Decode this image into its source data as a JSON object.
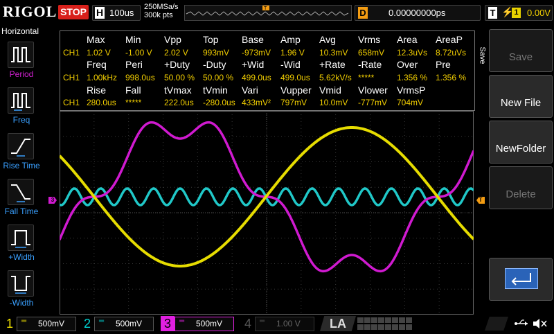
{
  "topbar": {
    "logo": "RIGOL",
    "run_state": "STOP",
    "h_label": "H",
    "timebase": "100us",
    "sample_rate": "250MSa/s",
    "memory_depth": "300k pts",
    "d_label": "D",
    "delay": "0.00000000ps",
    "t_label": "T",
    "trigger_edge_symbol": "⚡",
    "trigger_source": "1",
    "trigger_level": "0.00V"
  },
  "left_menu": {
    "title": "Horizontal",
    "items": [
      {
        "label": "Period",
        "icon": "period-icon",
        "active": true
      },
      {
        "label": "Freq",
        "icon": "freq-icon",
        "active": false
      },
      {
        "label": "Rise Time",
        "icon": "rise-time-icon",
        "active": false
      },
      {
        "label": "Fall Time",
        "icon": "fall-time-icon",
        "active": false
      },
      {
        "label": "+Width",
        "icon": "pos-width-icon",
        "active": false
      },
      {
        "label": "-Width",
        "icon": "neg-width-icon",
        "active": false
      }
    ]
  },
  "right_menu": {
    "tab_label": "Save",
    "buttons": [
      {
        "label": "Save",
        "enabled": false
      },
      {
        "label": "New File",
        "enabled": true
      },
      {
        "label": "NewFolder",
        "enabled": true
      },
      {
        "label": "Delete",
        "enabled": false
      },
      {
        "label": "",
        "icon": "return-icon",
        "enabled": true
      }
    ]
  },
  "measurements": {
    "rows": [
      {
        "headers": [
          "Max",
          "Min",
          "Vpp",
          "Top",
          "Base",
          "Amp",
          "Avg",
          "Vrms",
          "Area",
          "AreaP"
        ],
        "channel": "CH1",
        "values": [
          "1.02 V",
          "-1.00 V",
          "2.02 V",
          "993mV",
          "-973mV",
          "1.96 V",
          "10.3mV",
          "658mV",
          "12.3uVs",
          "8.72uVs"
        ]
      },
      {
        "headers": [
          "Freq",
          "Peri",
          "+Duty",
          "-Duty",
          "+Wid",
          "-Wid",
          "+Rate",
          "-Rate",
          "Over",
          "Pre"
        ],
        "channel": "CH1",
        "values": [
          "1.00kHz",
          "998.0us",
          "50.00 %",
          "50.00 %",
          "499.0us",
          "499.0us",
          "5.62kV/s",
          "*****",
          "1.356 %",
          "1.356 %"
        ]
      },
      {
        "headers": [
          "Rise",
          "Fall",
          "tVmax",
          "tVmin",
          "Vari",
          "Vupper",
          "Vmid",
          "Vlower",
          "VrmsP"
        ],
        "channel": "CH1",
        "values": [
          "280.0us",
          "*****",
          "222.0us",
          "-280.0us",
          "433mV²",
          "797mV",
          "10.0mV",
          "-777mV",
          "704mV"
        ]
      }
    ]
  },
  "markers": {
    "ch3_marker": "3",
    "trigger_marker": "T"
  },
  "channels": [
    {
      "number": "1",
      "scale": "500mV",
      "color": "#f4e400",
      "active": true
    },
    {
      "number": "2",
      "scale": "500mV",
      "color": "#00d2d2",
      "active": true
    },
    {
      "number": "3",
      "scale": "500mV",
      "color": "#e020e0",
      "active": true,
      "selected": true
    },
    {
      "number": "4",
      "scale": "1.00 V",
      "color": "#555555",
      "active": false
    }
  ],
  "la_label": "LA",
  "colors": {
    "ch1": "#e6dc00",
    "ch2": "#20c8c8",
    "ch3": "#d01ad0",
    "grid": "#3a3a3a"
  }
}
